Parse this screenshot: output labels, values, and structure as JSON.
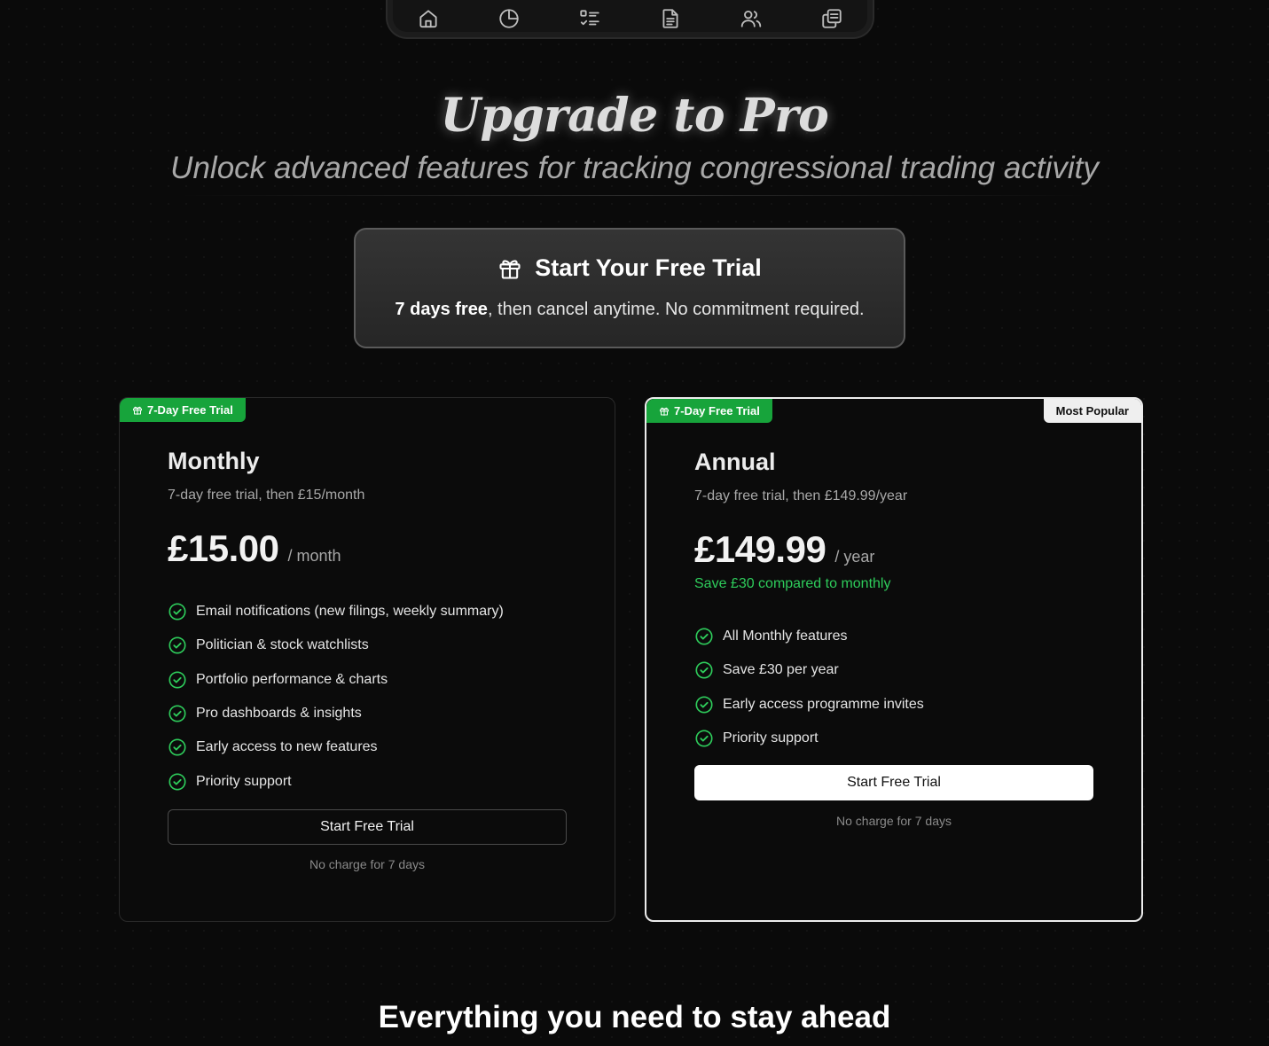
{
  "nav": {
    "items": [
      {
        "icon": "home-icon"
      },
      {
        "icon": "pie-chart-icon"
      },
      {
        "icon": "checklist-icon"
      },
      {
        "icon": "document-icon"
      },
      {
        "icon": "users-icon"
      },
      {
        "icon": "copy-icon"
      }
    ]
  },
  "hero": {
    "title": "Upgrade to Pro",
    "subtitle": "Unlock advanced features for tracking congressional trading activity"
  },
  "trial_banner": {
    "icon": "gift-icon",
    "title": "Start Your Free Trial",
    "body_bold": "7 days free",
    "body_rest": ", then cancel anytime. No commitment required."
  },
  "plans": {
    "monthly": {
      "tag": "7-Day Free Trial",
      "name": "Monthly",
      "description": "7-day free trial, then £15/month",
      "price": "£15.00",
      "period": "/ month",
      "features": [
        "Email notifications (new filings, weekly summary)",
        "Politician & stock watchlists",
        "Portfolio performance & charts",
        "Pro dashboards & insights",
        "Early access to new features",
        "Priority support"
      ],
      "cta": "Start Free Trial",
      "note": "No charge for 7 days"
    },
    "annual": {
      "tag": "7-Day Free Trial",
      "badge": "Most Popular",
      "name": "Annual",
      "description": "7-day free trial, then £149.99/year",
      "price": "£149.99",
      "period": "/ year",
      "savings": "Save £30 compared to monthly",
      "features": [
        "All Monthly features",
        "Save £30 per year",
        "Early access programme invites",
        "Priority support"
      ],
      "cta": "Start Free Trial",
      "note": "No charge for 7 days"
    }
  },
  "section": {
    "title": "Everything you need to stay ahead"
  },
  "colors": {
    "background": "#0a0a0a",
    "accent_green": "#17a43b",
    "check_green": "#2ecc5b",
    "text_primary": "#ececec",
    "text_muted": "#a8a8a8"
  }
}
